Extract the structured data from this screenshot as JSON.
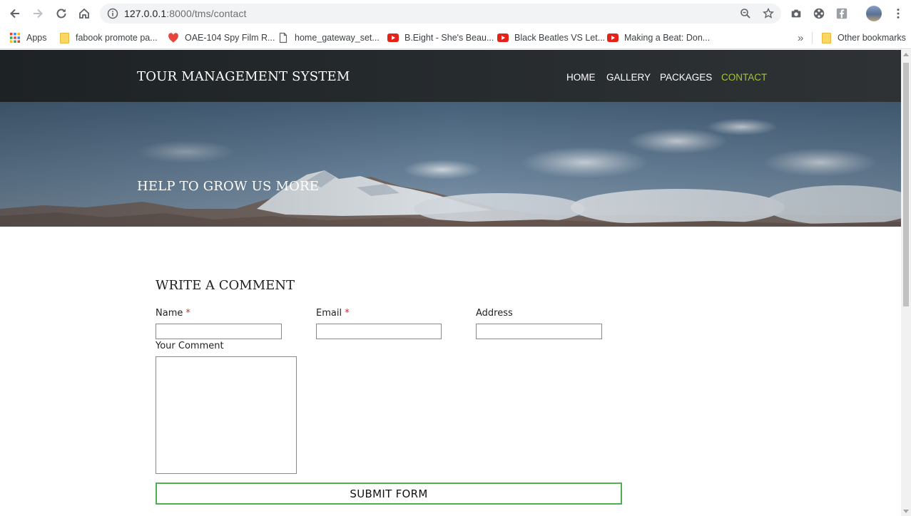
{
  "browser": {
    "url_host": "127.0.0.1",
    "url_rest": ":8000/tms/contact",
    "bookmarks": [
      {
        "label": "Apps",
        "icon": "apps-grid-icon"
      },
      {
        "label": "fabook promote pa...",
        "icon": "folder-icon"
      },
      {
        "label": "OAE-104 Spy Film R...",
        "icon": "heart-icon"
      },
      {
        "label": "home_gateway_set...",
        "icon": "page-icon"
      },
      {
        "label": "B.Eight - She's Beau...",
        "icon": "youtube-icon"
      },
      {
        "label": "Black Beatles VS Let...",
        "icon": "youtube-icon"
      },
      {
        "label": "Making a Beat: Don...",
        "icon": "youtube-icon"
      }
    ],
    "overflow_label": "»",
    "other_bookmarks": "Other bookmarks"
  },
  "site": {
    "title": "TOUR MANAGEMENT SYSTEM",
    "nav": [
      {
        "label": "HOME",
        "active": false
      },
      {
        "label": "GALLERY",
        "active": false
      },
      {
        "label": "PACKAGES",
        "active": false
      },
      {
        "label": "CONTACT",
        "active": true
      }
    ],
    "accent_color": "#a4c639"
  },
  "hero": {
    "title": "HELP TO GROW US MORE"
  },
  "form": {
    "title": "WRITE A COMMENT",
    "fields": {
      "name_label": "Name",
      "email_label": "Email",
      "address_label": "Address",
      "comment_label": "Your Comment",
      "required_marker": "*"
    },
    "values": {
      "name": "",
      "email": "",
      "address": "",
      "comment": ""
    },
    "submit_label": "SUBMIT FORM",
    "submit_border_color": "#4caf50"
  }
}
